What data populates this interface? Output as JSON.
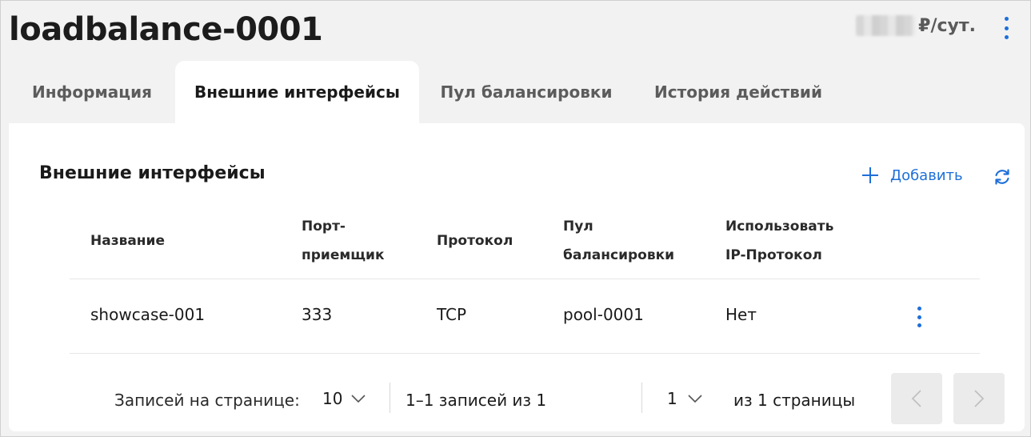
{
  "header": {
    "title": "loadbalance-0001",
    "price_suffix": "₽/сут.",
    "menu_icon": "kebab-vertical-icon"
  },
  "tabs": [
    {
      "label": "Информация",
      "active": false
    },
    {
      "label": "Внешние интерфейсы",
      "active": true
    },
    {
      "label": "Пул балансировки",
      "active": false
    },
    {
      "label": "История действий",
      "active": false
    }
  ],
  "section": {
    "title": "Внешние интерфейсы",
    "add_label": "Добавить",
    "add_icon": "plus-icon",
    "refresh_icon": "refresh-icon"
  },
  "table": {
    "columns": [
      {
        "line1": "Название",
        "line2": ""
      },
      {
        "line1": "Порт-",
        "line2": "приемщик"
      },
      {
        "line1": "Протокол",
        "line2": ""
      },
      {
        "line1": "Пул",
        "line2": "балансировки"
      },
      {
        "line1": "Использовать",
        "line2": "IP-Протокол"
      }
    ],
    "rows": [
      {
        "name": "showcase-001",
        "port": "333",
        "protocol": "TCP",
        "pool": "pool-0001",
        "use_ip": "Нет"
      }
    ]
  },
  "pagination": {
    "per_page_label": "Записей на странице:",
    "per_page_value": "10",
    "range_text": "1–1 записей из 1",
    "current_page": "1",
    "of_pages": "из 1 страницы"
  },
  "colors": {
    "accent": "#1e6fd9",
    "background": "#f2f2f2",
    "card": "#ffffff"
  }
}
